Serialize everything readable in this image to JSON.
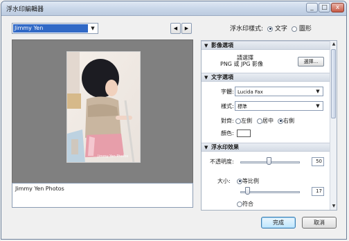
{
  "window": {
    "title": "浮水印編輯器",
    "close_label": "x",
    "minimize_label": "_",
    "maximize_label": "□"
  },
  "top": {
    "preset_value": "Jimmy Yen",
    "prev_label": "◀",
    "next_label": "▶",
    "watermark_style_label": "浮水印樣式:",
    "style_options": [
      {
        "label": "文字",
        "selected": true
      },
      {
        "label": "圖形",
        "selected": false
      }
    ]
  },
  "preview": {
    "watermark_text": "Jimmy Yen Photos"
  },
  "caption_text": "Jimmy Yen Photos",
  "panel": {
    "image_section": {
      "title": "影像選項",
      "prompt_line1": "請選擇",
      "prompt_line2": "PNG 或 JPG 影像",
      "choose_button": "選擇..."
    },
    "text_section": {
      "title": "文字選項",
      "font_label": "字體:",
      "font_value": "Lucida Fax",
      "style_label": "樣式:",
      "style_value": "標準",
      "align_label": "對齊:",
      "align_options": [
        {
          "label": "左側",
          "selected": false
        },
        {
          "label": "居中",
          "selected": false
        },
        {
          "label": "右側",
          "selected": true
        }
      ],
      "color_label": "顏色:",
      "color_value": "#ffffff"
    },
    "effect_section": {
      "title": "浮水印效果",
      "opacity_label": "不透明度:",
      "opacity_value": "50",
      "size_label": "大小:",
      "size_options": [
        {
          "label": "等比例",
          "selected": true
        },
        {
          "label": "符合",
          "selected": false
        }
      ],
      "size_value": "17"
    }
  },
  "buttons": {
    "ok": "完成",
    "cancel": "取消"
  },
  "colors": {
    "preview_bg": "#808080",
    "selection": "#3169c6"
  }
}
